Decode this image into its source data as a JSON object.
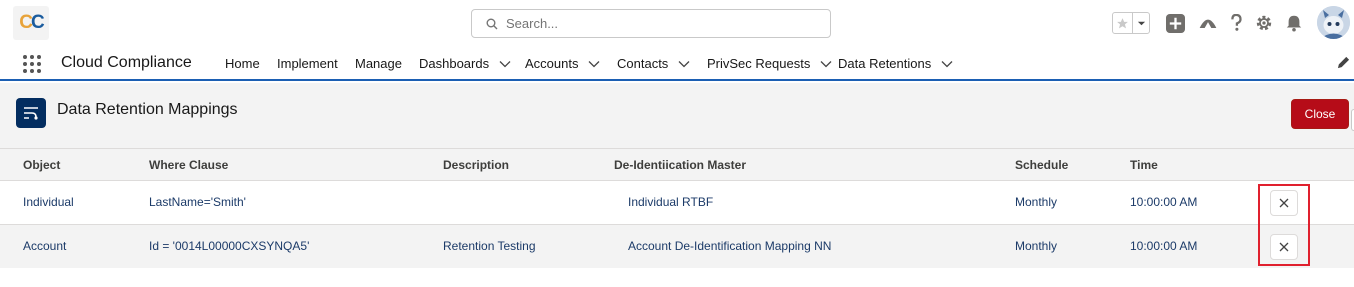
{
  "header": {
    "logo_text_1": "C",
    "logo_text_2": "C",
    "search_placeholder": "Search...",
    "icons": [
      "star-icon",
      "chevron-down-icon",
      "plus-icon",
      "trailhead-icon",
      "help-icon",
      "gear-icon",
      "bell-icon",
      "avatar"
    ]
  },
  "nav": {
    "app_name": "Cloud Compliance",
    "items": [
      {
        "label": "Home",
        "has_menu": false
      },
      {
        "label": "Implement",
        "has_menu": false
      },
      {
        "label": "Manage",
        "has_menu": false
      },
      {
        "label": "Dashboards",
        "has_menu": true
      },
      {
        "label": "Accounts",
        "has_menu": true
      },
      {
        "label": "Contacts",
        "has_menu": true
      },
      {
        "label": "PrivSec Requests",
        "has_menu": true
      },
      {
        "label": "Data Retentions",
        "has_menu": true
      }
    ]
  },
  "panel": {
    "title": "Data Retention Mappings",
    "close_label": "Close"
  },
  "table": {
    "columns": [
      "Object",
      "Where Clause",
      "Description",
      "De-Identiication Master",
      "Schedule",
      "Time"
    ],
    "rows": [
      {
        "object": "Individual",
        "where_clause": "LastName='Smith'",
        "description": "",
        "master": "Individual RTBF",
        "schedule": "Monthly",
        "time": "10:00:00 AM"
      },
      {
        "object": "Account",
        "where_clause": "Id = '0014L00000CXSYNQA5'",
        "description": "Retention Testing",
        "master": "Account De-Identification Mapping NN",
        "schedule": "Monthly",
        "time": "10:00:00 AM"
      }
    ]
  },
  "colors": {
    "accent": "#1b5fb3",
    "close_button": "#b60c18",
    "highlight": "#e0202e",
    "panel_icon": "#032d60"
  }
}
